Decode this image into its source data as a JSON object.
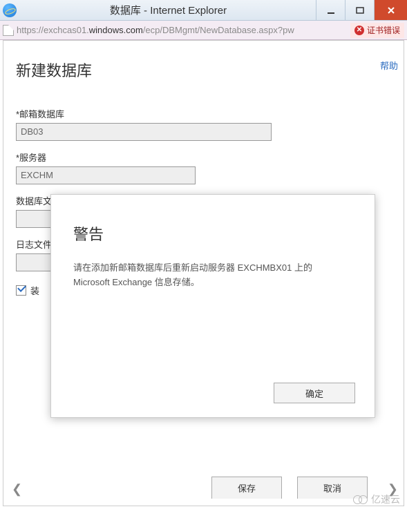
{
  "window": {
    "title": "数据库 - Internet Explorer"
  },
  "address": {
    "prefix": "https://exchcas01.",
    "host": "windows.com",
    "suffix": "/ecp/DBMgmt/NewDatabase.aspx?pw",
    "cert_error": "证书错误"
  },
  "page": {
    "help": "帮助",
    "title": "新建数据库",
    "mailbox_db_label": "*邮箱数据库",
    "mailbox_db_value": "DB03",
    "server_label": "*服务器",
    "server_value": "EXCHM",
    "db_path_label": "数据库文",
    "log_path_label": "日志文件",
    "mount_label": "装"
  },
  "modal": {
    "title": "警告",
    "body_line1": "请在添加新邮箱数据库后重新启动服务器 EXCHMBX01 上的",
    "body_line2": "Microsoft Exchange 信息存储。",
    "ok": "确定"
  },
  "footer": {
    "save": "保存",
    "cancel": "取消"
  },
  "watermark": "亿速云"
}
